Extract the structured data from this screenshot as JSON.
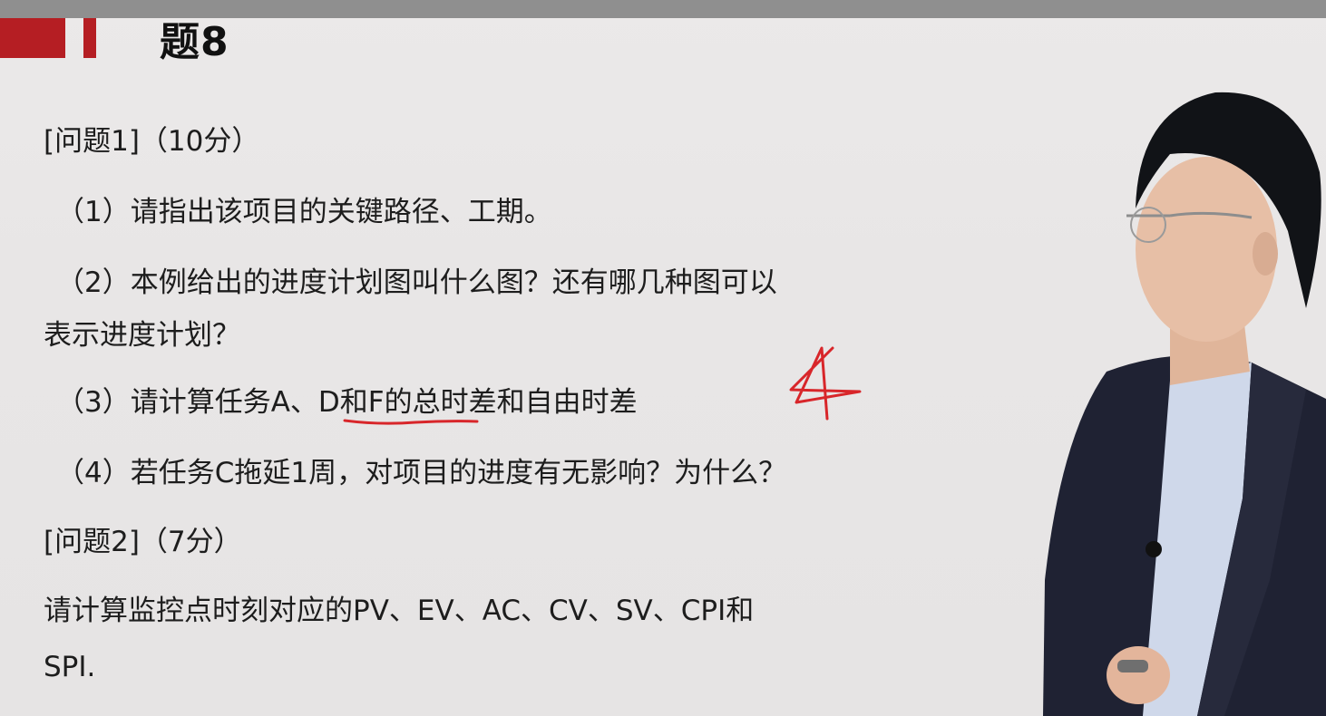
{
  "slide": {
    "title": "题8",
    "lines": [
      "[问题1]（10分）",
      "（1）请指出该项目的关键路径、工期。",
      "（2）本例给出的进度计划图叫什么图？还有哪几种图可以",
      "表示进度计划？",
      "（3）请计算任务A、D和F的总时差和自由时差",
      "（4）若任务C拖延1周，对项目的进度有无影响？为什么？",
      "[问题2]（7分）",
      "请计算监控点时刻对应的PV、EV、AC、CV、SV、CPI和",
      "SPI."
    ]
  },
  "colors": {
    "accent": "#b51e23",
    "annotation": "#d8262a",
    "background": "#e8e6e6"
  }
}
